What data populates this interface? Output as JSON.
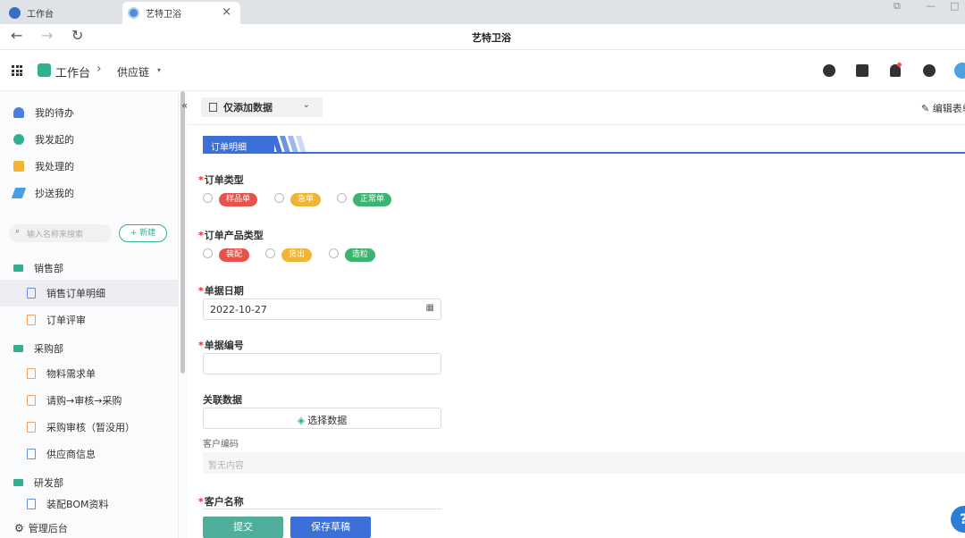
{
  "browser": {
    "tabs": [
      {
        "label": "工作台",
        "icon": "globe-icon"
      },
      {
        "label": "艺特卫浴",
        "icon": "app-logo-icon",
        "close": "×"
      }
    ],
    "window_controls": [
      "restore-icon",
      "minimize-icon",
      "maximize-icon"
    ],
    "title": "艺特卫浴",
    "nav": {
      "back": "←",
      "forward": "→",
      "reload": "↻"
    }
  },
  "header": {
    "workspace": "工作台",
    "separator": "›",
    "app": "供应链",
    "caret": "▾",
    "icons": [
      "compass-icon",
      "book-icon",
      "bell-icon",
      "help-icon",
      "avatar"
    ]
  },
  "sidebar": {
    "quick": [
      {
        "label": "我的待办",
        "icon": "bell-icon",
        "color": "#4a7ee0"
      },
      {
        "label": "我发起的",
        "icon": "play-icon",
        "color": "#30b08f"
      },
      {
        "label": "我处理的",
        "icon": "check-icon",
        "color": "#f0b534"
      },
      {
        "label": "抄送我的",
        "icon": "send-icon",
        "color": "#4a9ee0"
      }
    ],
    "search_placeholder": "输入名称来搜索",
    "new_button": "+ 新建",
    "departments": [
      {
        "label": "销售部",
        "items": [
          "销售订单明细",
          "订单评审"
        ]
      },
      {
        "label": "采购部",
        "items": [
          "物料需求单",
          "请购→审核→采购",
          "采购审核（暂没用）",
          "供应商信息"
        ]
      },
      {
        "label": "研发部",
        "items": [
          "装配BOM资料"
        ]
      }
    ],
    "admin": "管理后台"
  },
  "main": {
    "filter_label": "仅添加数据",
    "edit_label": "编辑表单",
    "section_tab": "订单明细",
    "fields": {
      "order_type": {
        "label": "订单类型",
        "options": [
          "样品单",
          "急单",
          "正常单"
        ],
        "colors": [
          "#e5534b",
          "#f0b534",
          "#3cb371"
        ]
      },
      "product_type": {
        "label": "订单产品类型",
        "options": [
          "装配",
          "货出",
          "造粒"
        ],
        "colors": [
          "#e5534b",
          "#f0b534",
          "#3cb371"
        ]
      },
      "date": {
        "label": "单据日期",
        "value": "2022-10-27"
      },
      "doc_no": {
        "label": "单据编号",
        "value": ""
      },
      "related": {
        "label": "关联数据",
        "button": "选择数据"
      },
      "customer_code": {
        "label": "客户编码",
        "placeholder": "暂无内容"
      },
      "customer_name": {
        "label": "客户名称"
      }
    },
    "actions": {
      "submit": "提交",
      "draft": "保存草稿"
    }
  }
}
